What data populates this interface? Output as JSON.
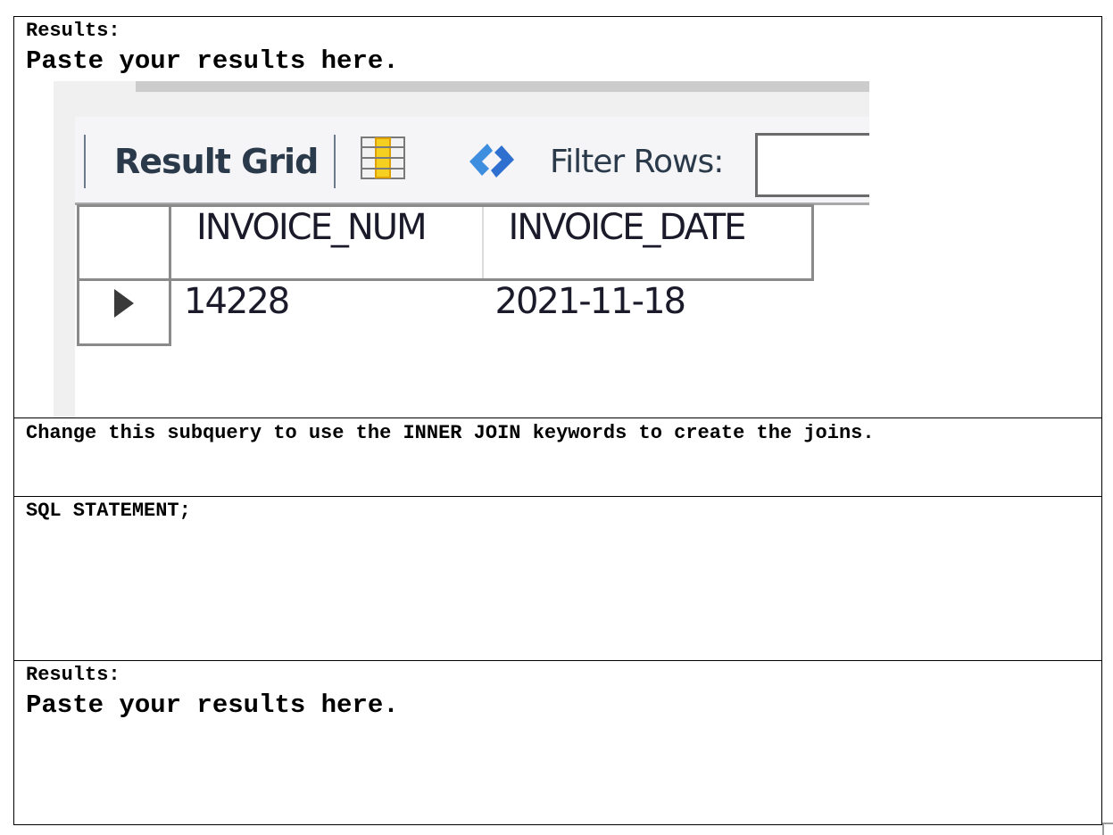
{
  "section1": {
    "results_label": "Results:",
    "placeholder": "Paste your results here.",
    "embedded_result": {
      "toolbar": {
        "result_grid_label": "Result Grid",
        "grid_icon": "column-grid-icon",
        "refresh_icon": "refresh-icon",
        "filter_label": "Filter Rows:",
        "filter_value": ""
      },
      "columns": [
        "INVOICE_NUM",
        "INVOICE_DATE"
      ],
      "rows": [
        {
          "INVOICE_NUM": "14228",
          "INVOICE_DATE": "2021-11-18"
        }
      ],
      "row_indicator_icon": "current-row-arrow-icon"
    }
  },
  "instruction": "Change this subquery to use the INNER JOIN keywords to create the joins.",
  "sql": {
    "label": "SQL STATEMENT;"
  },
  "section2": {
    "results_label": "Results:",
    "placeholder": "Paste your results here."
  }
}
